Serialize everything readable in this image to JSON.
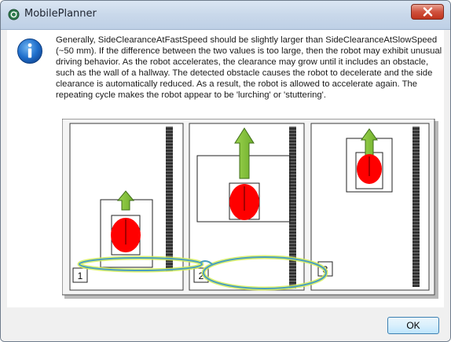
{
  "window": {
    "title": "MobilePlanner",
    "app_icon": "mobileplanner-app-icon",
    "close_icon": "close-icon"
  },
  "dialog": {
    "icon": "info-icon",
    "message": "Generally, SideClearanceAtFastSpeed should be slightly larger than SideClearanceAtSlowSpeed (~50 mm). If the difference between the two values is too large, then the robot may exhibit unusual driving behavior. As the robot accelerates, the clearance may grow until it includes an obstacle, such as the wall of a hallway. The detected obstacle causes the robot to decelerate and the side clearance is automatically reduced. As a result, the robot is allowed to accelerate again. The repeating cycle makes the robot appear to be 'lurching' or 'stuttering'."
  },
  "diagram": {
    "panel_labels": [
      "1",
      "2",
      "3"
    ],
    "colors": {
      "robot": "#ff0000",
      "arrow": "#8cc63f",
      "wall": "#3a3a3a",
      "cycle_ring": "#6fb3c9"
    }
  },
  "buttons": {
    "ok_label": "OK"
  }
}
